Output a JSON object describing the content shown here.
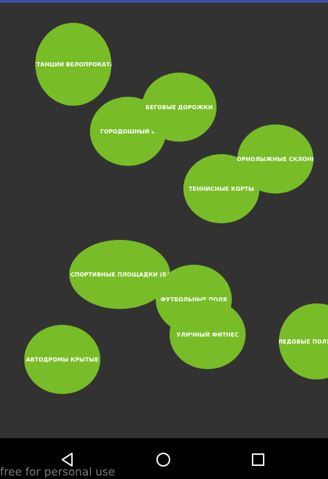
{
  "theme": {
    "background": "#323232",
    "status_bar": "#3f4fa8",
    "bubble_color": "#78bd27",
    "nav_background": "#000000",
    "nav_icon_color": "#ffffff"
  },
  "bubbles": [
    {
      "label": "СТАНЦИИ ВЕЛОПРОКАТА"
    },
    {
      "label": "БЕГОВЫЕ ДОРОЖКИ"
    },
    {
      "label": "ГОРОДОШНЫЙ СПОР"
    },
    {
      "label": "ГОРНОЛЫЖНЫЕ СКЛОНЫ"
    },
    {
      "label": "ТЕННИСНЫЕ КОРТЫ"
    },
    {
      "label": "СПОРТИВНЫЕ ПЛОЩАДКИ (БАСКЕТБОЛ"
    },
    {
      "label": "ФУТБОЛЬНЫЕ ПОЛЯ"
    },
    {
      "label": "УЛИЧНЫЙ ФИТНЕС"
    },
    {
      "label": "ЛЕДОВЫЕ ПОЛЯ"
    },
    {
      "label": "АВТОДРОМЫ КРЫТЫЕ"
    }
  ],
  "nav": {
    "back": "back-icon",
    "home": "home-icon",
    "recents": "recents-icon"
  },
  "watermark": "free for personal use"
}
